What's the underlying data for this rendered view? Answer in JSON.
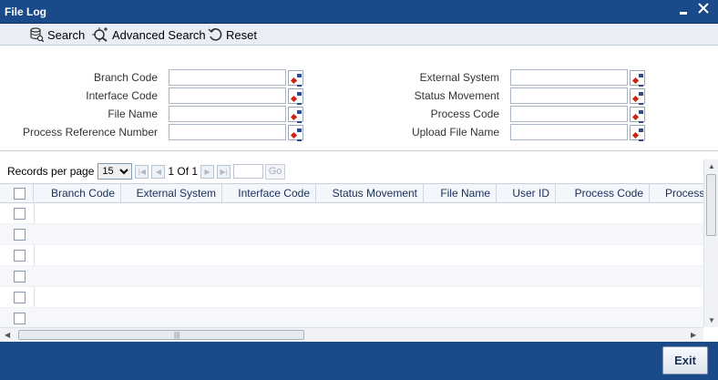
{
  "window": {
    "title": "File Log",
    "minimize_label": "▄",
    "close_label": "✕"
  },
  "toolbar": {
    "search_label": "Search",
    "advanced_search_label": "Advanced Search",
    "reset_label": "Reset"
  },
  "form": {
    "left_fields": [
      {
        "label": "Branch Code",
        "value": ""
      },
      {
        "label": "Interface Code",
        "value": ""
      },
      {
        "label": "File Name",
        "value": ""
      },
      {
        "label": "Process Reference Number",
        "value": ""
      }
    ],
    "right_fields": [
      {
        "label": "External System",
        "value": ""
      },
      {
        "label": "Status Movement",
        "value": ""
      },
      {
        "label": "Process Code",
        "value": ""
      },
      {
        "label": "Upload File Name",
        "value": ""
      }
    ]
  },
  "pager": {
    "records_per_page_label": "Records per page",
    "records_per_page_value": "15",
    "page_info": "1 Of 1",
    "go_label": "Go"
  },
  "table": {
    "columns": [
      "Branch Code",
      "External System",
      "Interface Code",
      "Status Movement",
      "File Name",
      "User ID",
      "Process Code",
      "Process"
    ],
    "row_count": 6
  },
  "footer": {
    "exit_label": "Exit"
  },
  "colors": {
    "titlebar": "#1a4a8a",
    "toolbar": "#e9eef6"
  }
}
